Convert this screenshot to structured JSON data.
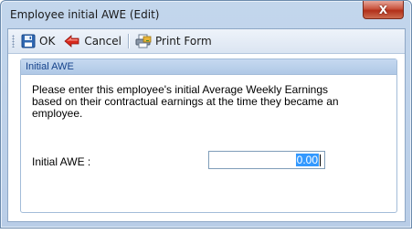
{
  "window": {
    "title": "Employee initial AWE (Edit)",
    "close_glyph": "X"
  },
  "toolbar": {
    "ok_label": "OK",
    "cancel_label": "Cancel",
    "print_label": "Print Form",
    "icons": [
      "save-icon",
      "back-arrow-icon",
      "print-form-icon"
    ]
  },
  "group": {
    "header": "Initial AWE",
    "description": "Please enter this employee's initial Average Weekly Earnings based on their contractual earnings at the time they became an employee.",
    "field_label": "Initial AWE :",
    "field_value": "0.00"
  },
  "colors": {
    "frame": "#b9cde7",
    "header_text": "#15428b",
    "selection": "#3399ff",
    "close_button": "#c9553f"
  }
}
